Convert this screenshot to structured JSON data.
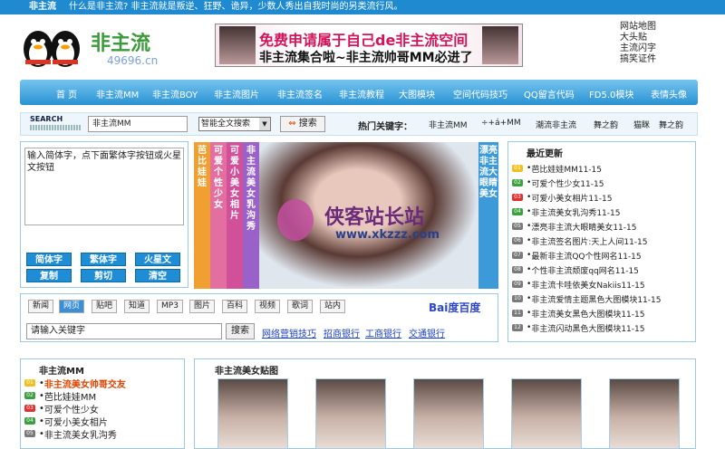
{
  "topbar": {
    "site": "非主流",
    "tagline": "什么是非主流? 非主流就是叛逆、狂野、诡异，少数人秀出自我时尚的另类流行风。"
  },
  "logo": {
    "title": "非主流",
    "domain": "49696.cn"
  },
  "banner": {
    "line1": "免费申请属于自己de非主流空间",
    "line2": "非主流集合啦~非主流帅哥MM必进了"
  },
  "right_links": [
    "网站地图",
    "大头贴",
    "主流闪字",
    "搞笑证件"
  ],
  "nav": [
    "首 页",
    "非主流MM",
    "非主流BOY",
    "非主流图片",
    "非主流签名",
    "非主流教程",
    "大图模块",
    "空间代码技巧",
    "QQ留言代码",
    "FD5.0模块",
    "表情头像"
  ],
  "search": {
    "label": "SEARCH",
    "input": "非主流MM",
    "select": "智能全文搜索",
    "button": "搜索",
    "hot_label": "热门关键字：",
    "hot": [
      "非主流MM",
      "÷+á+MM",
      "潮流非主流",
      "舞之韵",
      "猫眯",
      "舞之韵"
    ]
  },
  "converter": {
    "placeholder": "输入简体字，点下面繁体字按钮或火星文按钮",
    "buttons": [
      "简体字",
      "繁体字",
      "火星文",
      "复制",
      "剪切",
      "清空"
    ]
  },
  "vtabs": [
    "芭比娃娃",
    "可爱个性少女",
    "可爱小美女相片",
    "非主流美女乳沟秀"
  ],
  "vtab_right": "漂亮非主流大眼睛美女",
  "watermark": {
    "title": "侠客站长站",
    "url": "www.xkzzz.com"
  },
  "baidu": {
    "tabs": [
      "新闻",
      "网页",
      "贴吧",
      "知道",
      "MP3",
      "图片",
      "百科",
      "视频",
      "歌词",
      "站内"
    ],
    "input": "请输入关键字",
    "button": "搜索",
    "links": [
      "网络营销技巧",
      "招商银行",
      "工商银行",
      "交通银行"
    ],
    "brand": "Bai度百度"
  },
  "updates": {
    "title": "最近更新",
    "items": [
      "芭比娃娃MM11-15",
      "可爱个性少女11-15",
      "可爱小美女相片11-15",
      "非主流美女乳沟秀11-15",
      "漂亮非主流大眼睛美女11-15",
      "非主流签名图片:天上人间11-15",
      "最新非主流QQ个性网名11-15",
      "个性非主流颓废qq网名11-15",
      "非主流卡哇依美女Nakiis11-15",
      "非主流爱情主题黑色大图模块11-15",
      "非主流美女黑色大图模块11-15",
      "非主流闪动黑色大图模块11-15"
    ],
    "nums": [
      "01",
      "02",
      "03",
      "04",
      "05",
      "06",
      "07",
      "08",
      "09",
      "10",
      "11",
      "12"
    ]
  },
  "mm": {
    "title": "非主流MM",
    "items": [
      "非主流美女帅哥交友",
      "芭比娃娃MM",
      "可爱个性少女",
      "可爱小美女相片",
      "非主流美女乳沟秀"
    ],
    "nums": [
      "01",
      "02",
      "03",
      "04",
      "05"
    ]
  },
  "gallery": {
    "title": "非主流美女贴图"
  },
  "colors": {
    "nav": "#2a92d2",
    "accent": "#d4145a"
  }
}
